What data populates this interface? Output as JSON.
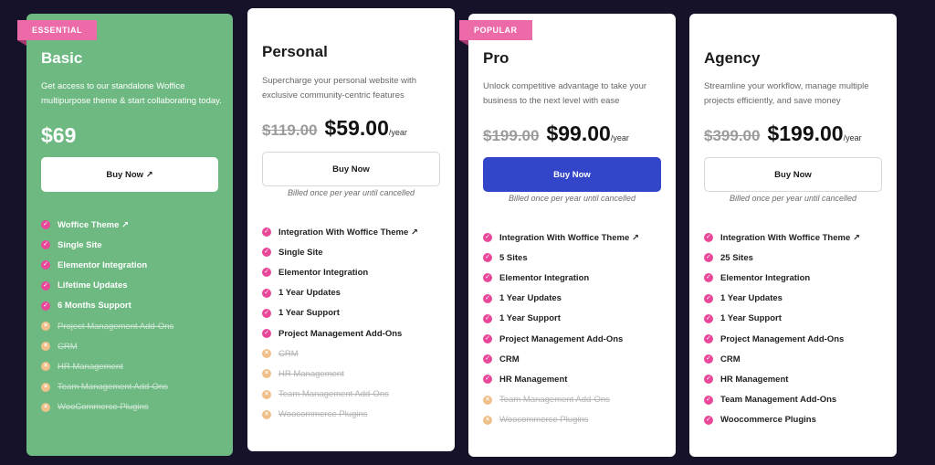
{
  "plans": [
    {
      "ribbon": "ESSENTIAL",
      "name": "Basic",
      "desc": "Get access to our standalone Woffice multipurpose theme & start collaborating today.",
      "old_price": "",
      "price": "$69",
      "per": "",
      "button": "Buy Now ↗",
      "billed": "",
      "features": [
        {
          "label": "Woffice Theme ↗",
          "included": true
        },
        {
          "label": "Single Site",
          "included": true
        },
        {
          "label": "Elementor Integration",
          "included": true
        },
        {
          "label": "Lifetime Updates",
          "included": true
        },
        {
          "label": "6 Months Support",
          "included": true
        },
        {
          "label": "Project Management Add-Ons",
          "included": false
        },
        {
          "label": "CRM",
          "included": false
        },
        {
          "label": "HR Management",
          "included": false
        },
        {
          "label": "Team Management Add-Ons",
          "included": false
        },
        {
          "label": "WooCommerce Plugins",
          "included": false
        }
      ]
    },
    {
      "ribbon": "",
      "name": "Personal",
      "desc": "Supercharge your personal website with exclusive community-centric features",
      "old_price": "$119.00",
      "price": "$59.00",
      "per": "/year",
      "button": "Buy Now",
      "billed": "Billed once per year until cancelled",
      "features": [
        {
          "label": "Integration With Woffice Theme ↗",
          "included": true
        },
        {
          "label": "Single Site",
          "included": true
        },
        {
          "label": "Elementor Integration",
          "included": true
        },
        {
          "label": "1 Year Updates",
          "included": true
        },
        {
          "label": "1 Year Support",
          "included": true
        },
        {
          "label": "Project Management Add-Ons",
          "included": true
        },
        {
          "label": "CRM",
          "included": false
        },
        {
          "label": "HR Management",
          "included": false
        },
        {
          "label": "Team Management Add-Ons",
          "included": false
        },
        {
          "label": "Woocommerce Plugins",
          "included": false
        }
      ]
    },
    {
      "ribbon": "POPULAR",
      "name": "Pro",
      "desc": "Unlock competitive advantage to take your business to the next level with ease",
      "old_price": "$199.00",
      "price": "$99.00",
      "per": "/year",
      "button": "Buy Now",
      "billed": "Billed once per year until cancelled",
      "features": [
        {
          "label": "Integration With Woffice Theme ↗",
          "included": true
        },
        {
          "label": "5 Sites",
          "included": true
        },
        {
          "label": "Elementor Integration",
          "included": true
        },
        {
          "label": "1 Year Updates",
          "included": true
        },
        {
          "label": "1 Year Support",
          "included": true
        },
        {
          "label": "Project Management Add-Ons",
          "included": true
        },
        {
          "label": "CRM",
          "included": true
        },
        {
          "label": "HR Management",
          "included": true
        },
        {
          "label": "Team Management Add-Ons",
          "included": false
        },
        {
          "label": "Woocommerce Plugins",
          "included": false
        }
      ]
    },
    {
      "ribbon": "",
      "name": "Agency",
      "desc": "Streamline your workflow, manage multiple projects efficiently, and save money",
      "old_price": "$399.00",
      "price": "$199.00",
      "per": "/year",
      "button": "Buy Now",
      "billed": "Billed once per year until cancelled",
      "features": [
        {
          "label": "Integration With Woffice Theme ↗",
          "included": true
        },
        {
          "label": "25 Sites",
          "included": true
        },
        {
          "label": "Elementor Integration",
          "included": true
        },
        {
          "label": "1 Year Updates",
          "included": true
        },
        {
          "label": "1 Year Support",
          "included": true
        },
        {
          "label": "Project Management Add-Ons",
          "included": true
        },
        {
          "label": "CRM",
          "included": true
        },
        {
          "label": "HR Management",
          "included": true
        },
        {
          "label": "Team Management Add-Ons",
          "included": true
        },
        {
          "label": "Woocommerce Plugins",
          "included": true
        }
      ]
    }
  ],
  "icons": {
    "included": "check-circle-icon",
    "excluded": "x-circle-icon"
  },
  "colors": {
    "background": "#16122a",
    "basic_card": "#6db981",
    "accent_pink": "#ec6aa8",
    "primary_blue": "#3345c8"
  }
}
